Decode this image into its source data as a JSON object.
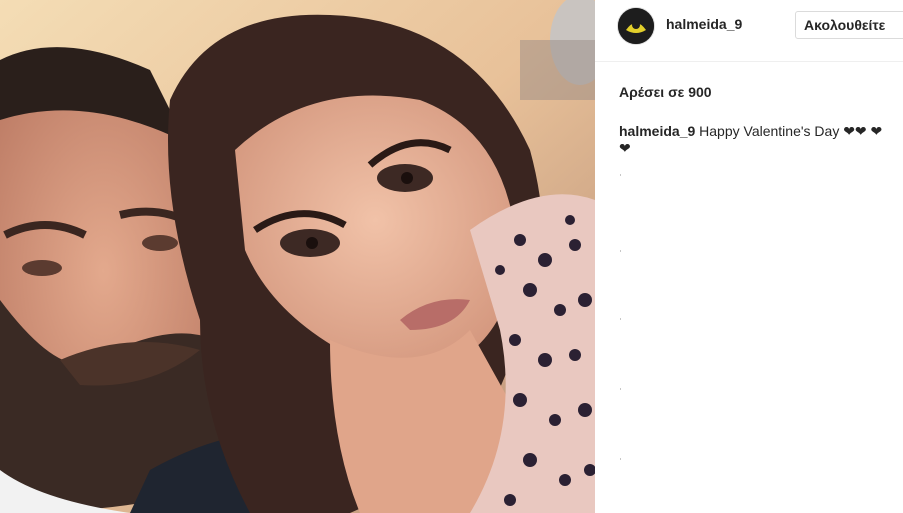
{
  "post": {
    "username": "halmeida_9",
    "follow_label": "Ακολουθείτε",
    "likes_text": "Αρέσει σε 900",
    "caption_user": "halmeida_9",
    "caption_text": "Happy Valentine's Day ❤❤ ❤❤"
  },
  "icons": {
    "avatar": "profile-avatar-yellow-emblem"
  }
}
